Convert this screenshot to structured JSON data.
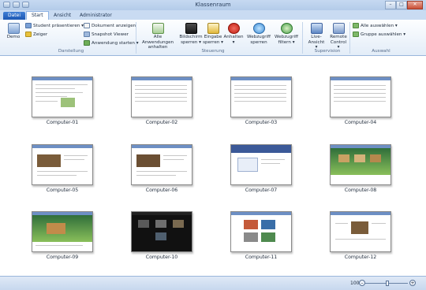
{
  "window": {
    "title": "Klassenraum",
    "minimize": "–",
    "maximize": "□",
    "close": "✕"
  },
  "tabs": [
    "Datei",
    "Start",
    "Ansicht",
    "Administrator"
  ],
  "ribbon": {
    "demo": "Demo",
    "student_present": "Student präsentieren ▾",
    "pointer": "Zeiger",
    "group_darstellung": "Darstellung",
    "doc_show": "Dokument anzeigen",
    "snapshot": "Snapshot Viewer",
    "app_start": "Anwendung starten ▾",
    "stop_all_1": "Alle Anwendungen",
    "stop_all_2": "anhalten",
    "lock_screen_1": "Bildschirm",
    "lock_screen_2": "sperren ▾",
    "lock_input_1": "Eingabe",
    "lock_input_2": "sperren ▾",
    "stop_1": "Anhalten",
    "stop_2": "▾",
    "group_steuerung": "Steuerung",
    "web_lock_1": "Webzugriff",
    "web_lock_2": "sperren",
    "web_filter_1": "Webzugriff",
    "web_filter_2": "filtern ▾",
    "live_1": "Live-Ansicht",
    "live_2": "▾",
    "remote_1": "Remote",
    "remote_2": "Control ▾",
    "group_supervision": "Supervision",
    "select_all": "Alle auswählen ▾",
    "select_group": "Gruppe auswählen ▾",
    "group_auswahl": "Auswahl"
  },
  "computers": [
    "Computer-01",
    "Computer-02",
    "Computer-03",
    "Computer-04",
    "Computer-05",
    "Computer-06",
    "Computer-07",
    "Computer-08",
    "Computer-09",
    "Computer-10",
    "Computer-11",
    "Computer-12"
  ],
  "status": {
    "zoom": "100%",
    "zoom_minus": "–",
    "zoom_plus": "+"
  },
  "colors": {
    "accent": "#1c57b3",
    "ribbon_bg": "#e3edf8",
    "stop_red": "#d32a1e"
  }
}
